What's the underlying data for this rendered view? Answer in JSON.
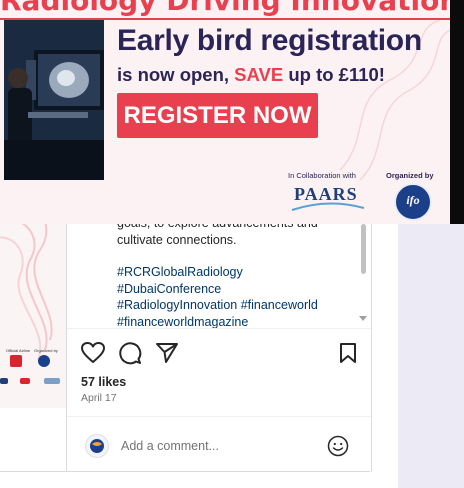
{
  "banner": {
    "top_text": "Radiology Driving Innovation",
    "headline": "Early bird registration",
    "subline_pre": "is now open, ",
    "subline_highlight": "SAVE",
    "subline_post": " up to £110!",
    "cta_label": "REGISTER NOW",
    "collab_label": "In Collaboration with",
    "partner_logo_text": "PAARS",
    "organizer_label": "Organized by",
    "organizer_logo_text": "ifo",
    "colors": {
      "accent": "#e8404e",
      "navy": "#2b2456",
      "background": "#fdf2f3"
    }
  },
  "post": {
    "caption_partial": "goals, to explore advancements and cultivate connections.",
    "caption_continued": "cultivate connections.",
    "hashtags_line1": "#RCRGlobalRadiology",
    "hashtags_line2": "#DubaiConference",
    "hashtags_line3": "#RadiologyInnovation #financeworld",
    "hashtags_line4": "#financeworldmagazine",
    "likes": "57 likes",
    "date": "April 17",
    "comment_placeholder": "Add a comment..."
  },
  "icons": {
    "like": "heart-outline-icon",
    "comment": "speech-bubble-icon",
    "share": "paper-plane-icon",
    "save": "bookmark-icon",
    "emoji": "smiley-icon"
  },
  "colors": {
    "hashtag": "#00376b",
    "text": "#262626",
    "muted": "#737373",
    "gutter": "#eceaf4"
  }
}
